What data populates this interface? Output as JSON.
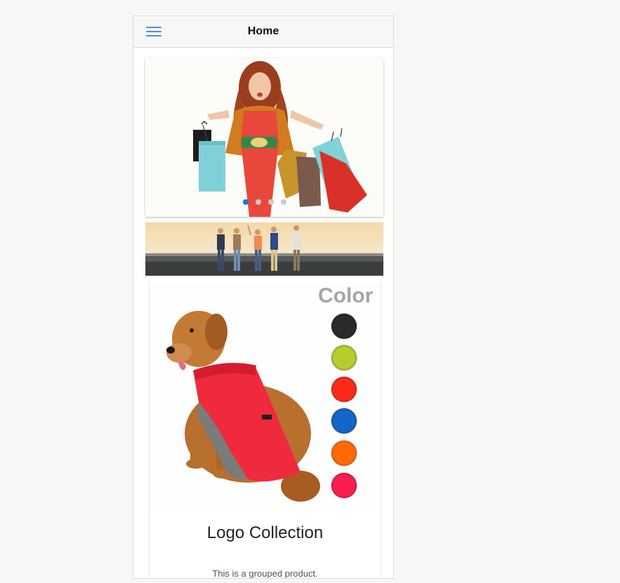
{
  "header": {
    "title": "Home",
    "menu_icon": "hamburger-menu-icon",
    "accent_color": "#4a90e2"
  },
  "slider": {
    "slide_count": 4,
    "active_index": 0,
    "image": "woman-with-shopping-bags"
  },
  "banner": {
    "image": "group-of-friends-walking"
  },
  "product": {
    "image": "dog-in-red-coat",
    "color_label": "Color",
    "color_options": [
      "#2a2a2c",
      "#b8cc2e",
      "#fb2a1c",
      "#1565c9",
      "#ff6a06",
      "#fb1d4f"
    ],
    "name": "Logo Collection",
    "description": "This is a grouped product."
  }
}
